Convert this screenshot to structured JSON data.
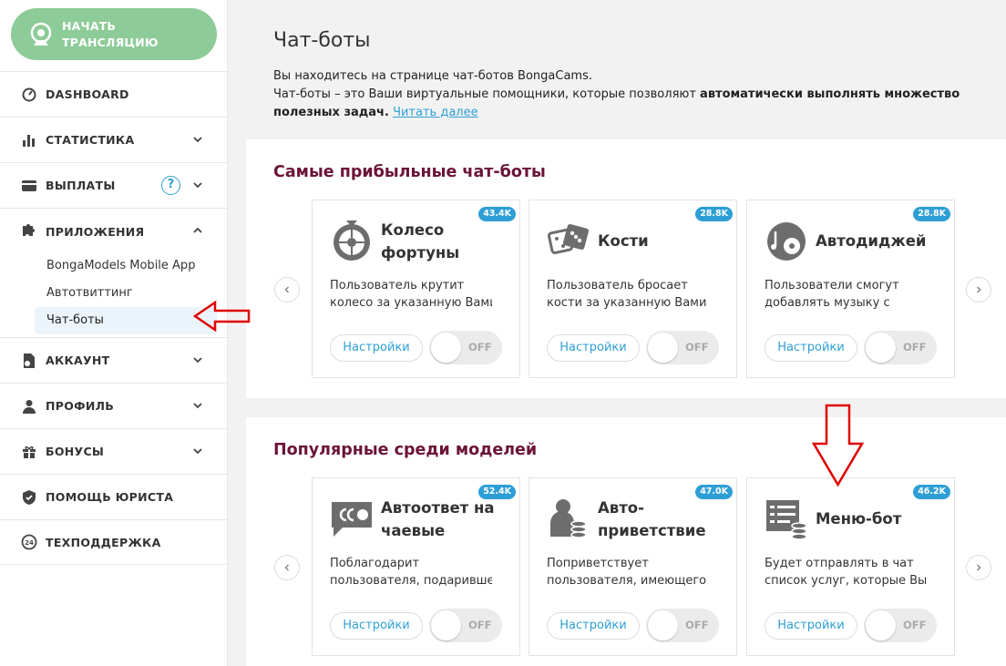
{
  "sidebar": {
    "start_button": "НАЧАТЬ ТРАНСЛЯЦИЮ",
    "items": [
      {
        "label": "DASHBOARD",
        "icon": "dashboard-icon"
      },
      {
        "label": "СТАТИСТИКА",
        "icon": "stats-icon"
      },
      {
        "label": "ВЫПЛАТЫ",
        "icon": "card-icon",
        "help": "?"
      },
      {
        "label": "ПРИЛОЖЕНИЯ",
        "icon": "puzzle-icon"
      },
      {
        "label": "АККАУНТ",
        "icon": "account-icon"
      },
      {
        "label": "ПРОФИЛЬ",
        "icon": "profile-icon"
      },
      {
        "label": "БОНУСЫ",
        "icon": "gift-icon"
      },
      {
        "label": "ПОМОЩЬ ЮРИСТА",
        "icon": "shield-icon"
      },
      {
        "label": "ТЕХПОДДЕРЖКА",
        "icon": "support-icon"
      }
    ],
    "apps_sub": [
      "BongaModels Mobile App",
      "Автотвиттинг",
      "Чат-боты"
    ]
  },
  "main": {
    "title": "Чат-боты",
    "intro_line1": "Вы находитесь на странице чат-ботов BongaCams.",
    "intro_line2a": "Чат-боты – это Ваши виртуальные помощники, которые позволяют ",
    "intro_bold": "автоматически выполнять множество полезных задач.",
    "intro_link": "Читать далее"
  },
  "sections": [
    {
      "title": "Самые прибыльные чат-боты",
      "cards": [
        {
          "title": "Колесо фортуны",
          "badge": "43.4K",
          "desc1": "Пользователь крутит",
          "desc2": "колесо за указанную Вами",
          "icon": "wheel-icon"
        },
        {
          "title": "Кости",
          "badge": "28.8K",
          "desc1": "Пользователь бросает",
          "desc2": "кости за указанную Вами",
          "icon": "dice-icon"
        },
        {
          "title": "Автодиджей",
          "badge": "28.8K",
          "desc1": "Пользователи смогут",
          "desc2": "добавлять музыку с",
          "icon": "music-icon"
        }
      ]
    },
    {
      "title": "Популярные среди моделей",
      "cards": [
        {
          "title": "Автоответ на чаевые",
          "badge": "52.4K",
          "desc1": "Поблагодарит",
          "desc2": "пользователя, подарившего",
          "icon": "reply-icon"
        },
        {
          "title": "Авто-приветствие",
          "badge": "47.0K",
          "desc1": "Поприветствует",
          "desc2": "пользователя, имеющего",
          "icon": "greeting-icon"
        },
        {
          "title": "Меню-бот",
          "badge": "46.2K",
          "desc1": "Будет отправлять в чат",
          "desc2": "список услуг, которые Вы",
          "icon": "menu-icon"
        }
      ]
    }
  ],
  "card_settings_label": "Настройки",
  "toggle_off_label": "OFF",
  "colors": {
    "accent": "#2e9fd6",
    "start": "#8dcb98",
    "section_title": "#6b1438",
    "annotation": "#e00000"
  }
}
